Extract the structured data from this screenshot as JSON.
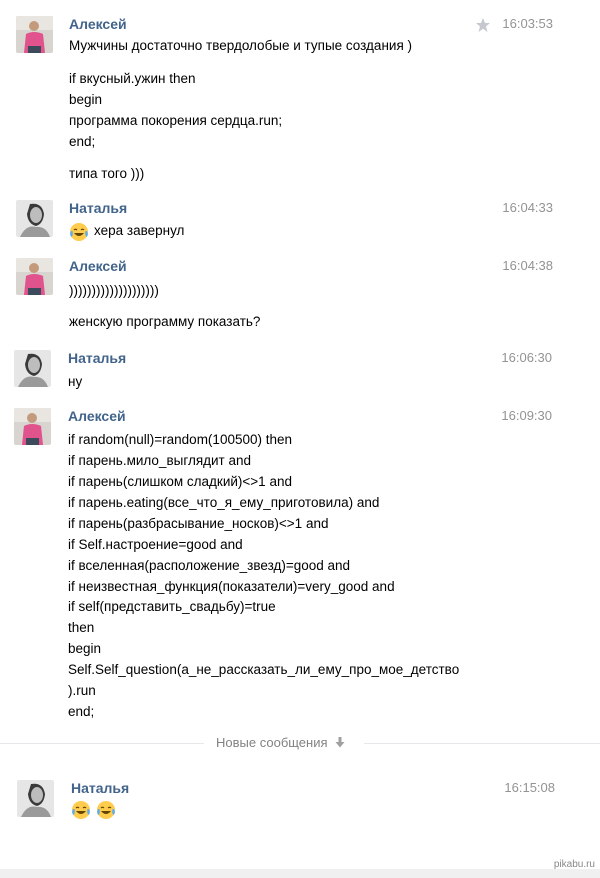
{
  "messages": [
    {
      "author": "Алексей",
      "time": "16:03:53",
      "lines": [
        "Мужчины достаточно твердолобые и тупые создания )",
        "if вкусный.ужин then",
        "begin",
        "программа покорения сердца.run;",
        "end;",
        "типа того )))"
      ]
    },
    {
      "author": "Наталья",
      "time": "16:04:33",
      "lines": [
        "хера завернул"
      ]
    },
    {
      "author": "Алексей",
      "time": "16:04:38",
      "lines": [
        "))))))))))))))))))))",
        "женскую программу показать?"
      ]
    },
    {
      "author": "Наталья",
      "time": "16:06:30",
      "lines": [
        "ну"
      ]
    },
    {
      "author": "Алексей",
      "time": "16:09:30",
      "lines": [
        "if random(null)=random(100500) then",
        "if парень.мило_выглядит and",
        "if парень(слишком сладкий)<>1 and",
        "if парень.eating(все_что_я_ему_приготовила) and",
        "if парень(разбрасывание_носков)<>1 and",
        "if Self.настроение=good and",
        "if вселенная(расположение_звезд)=good and",
        "if неизвестная_функция(показатели)=very_good and",
        "if self(представить_свадьбу)=true",
        "then",
        "begin",
        "Self.Self_question(а_не_рассказать_ли_ему_про_мое_детство",
        ").run",
        "end;"
      ]
    },
    {
      "author": "Наталья",
      "time": "16:15:08",
      "lines": []
    }
  ],
  "divider": {
    "label": "Новые сообщения",
    "icon": "arrow-down-icon"
  },
  "watermark": "pikabu.ru",
  "icons": {
    "star": "star-icon",
    "laugh_emoji": "tears-of-joy-emoji"
  },
  "colors": {
    "author_name": "#42648b",
    "time": "#939393",
    "divider_text": "#828282",
    "star": "#c5c9cf"
  }
}
